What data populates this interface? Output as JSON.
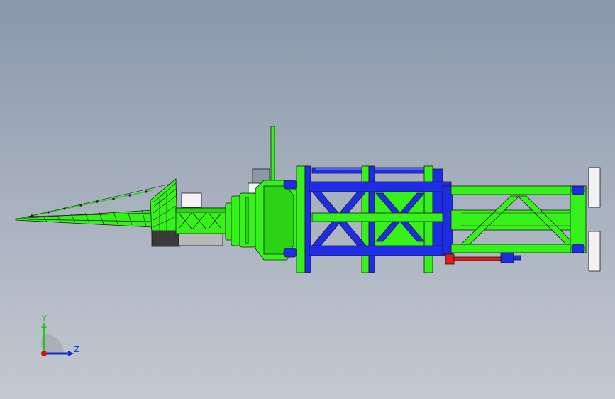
{
  "viewport": {
    "background_top": "#8a98ac",
    "background_bottom": "#c4c9d1"
  },
  "model": {
    "colors": {
      "green_frame": "#36f21a",
      "blue_frame": "#1f2ce6",
      "red_part": "#e31b1b",
      "white_part": "#f2f2f2",
      "outline": "#1a1a1a"
    }
  },
  "triad": {
    "y_label": "Y",
    "z_label": "Z",
    "y_color": "#1ec81e",
    "z_color": "#1530c8",
    "origin_color": "#e01010"
  }
}
